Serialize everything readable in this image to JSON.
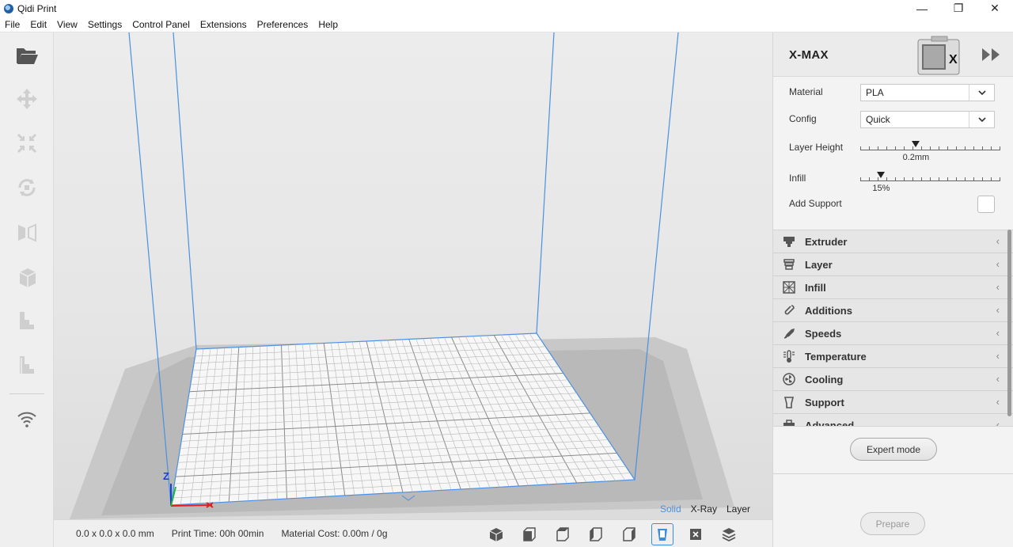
{
  "window": {
    "title": "Qidi Print",
    "minimize_glyph": "—",
    "restore_glyph": "❐",
    "close_glyph": "✕"
  },
  "menu": [
    "File",
    "Edit",
    "View",
    "Settings",
    "Control Panel",
    "Extensions",
    "Preferences",
    "Help"
  ],
  "left_toolbar": [
    "open-folder-icon",
    "move-icon",
    "scale-icon",
    "rotate-icon",
    "mirror-icon",
    "per-model-settings-icon",
    "support-blocker-icon",
    "layflat-icon",
    "wifi-icon"
  ],
  "viewport": {
    "view_modes": [
      "Solid",
      "X-Ray",
      "Layer"
    ],
    "active_view_mode": "Solid",
    "axis_z_label": "Z",
    "axis_z_color": "#1a3fd6",
    "axis_x_color": "#e02020",
    "axis_y_color": "#22b33a",
    "build_volume_color": "#4a90e2"
  },
  "status": {
    "dimensions": "0.0 x 0.0 x 0.0 mm",
    "print_time": "Print Time: 00h 00min",
    "material_cost": "Material Cost: 0.00m / 0g"
  },
  "view_icons": [
    "3d-view-icon",
    "front-view-icon",
    "top-view-icon",
    "left-view-icon",
    "right-view-icon",
    "machine-view-icon",
    "x-view-icon",
    "layers-view-icon"
  ],
  "active_view_icon": "machine-view-icon",
  "printer": {
    "name": "X-MAX",
    "image_letter": "X"
  },
  "settings": {
    "material_label": "Material",
    "material_value": "PLA",
    "config_label": "Config",
    "config_value": "Quick",
    "layer_height_label": "Layer Height",
    "layer_height_value": "0.2mm",
    "layer_height_fraction": 0.4,
    "infill_label": "Infill",
    "infill_value": "15%",
    "infill_fraction": 0.15,
    "add_support_label": "Add Support",
    "add_support_checked": false
  },
  "sections": [
    {
      "name": "Extruder",
      "icon": "extruder-icon"
    },
    {
      "name": "Layer",
      "icon": "layer-icon"
    },
    {
      "name": "Infill",
      "icon": "infill-icon"
    },
    {
      "name": "Additions",
      "icon": "additions-icon"
    },
    {
      "name": "Speeds",
      "icon": "speeds-icon"
    },
    {
      "name": "Temperature",
      "icon": "temperature-icon"
    },
    {
      "name": "Cooling",
      "icon": "cooling-icon"
    },
    {
      "name": "Support",
      "icon": "support-icon"
    },
    {
      "name": "Advanced",
      "icon": "advanced-icon"
    }
  ],
  "buttons": {
    "expert_mode": "Expert mode",
    "prepare": "Prepare"
  },
  "colors": {
    "accent": "#3b8ede",
    "panel_bg": "#f3f3f3",
    "section_bg": "#e6e6e6"
  }
}
